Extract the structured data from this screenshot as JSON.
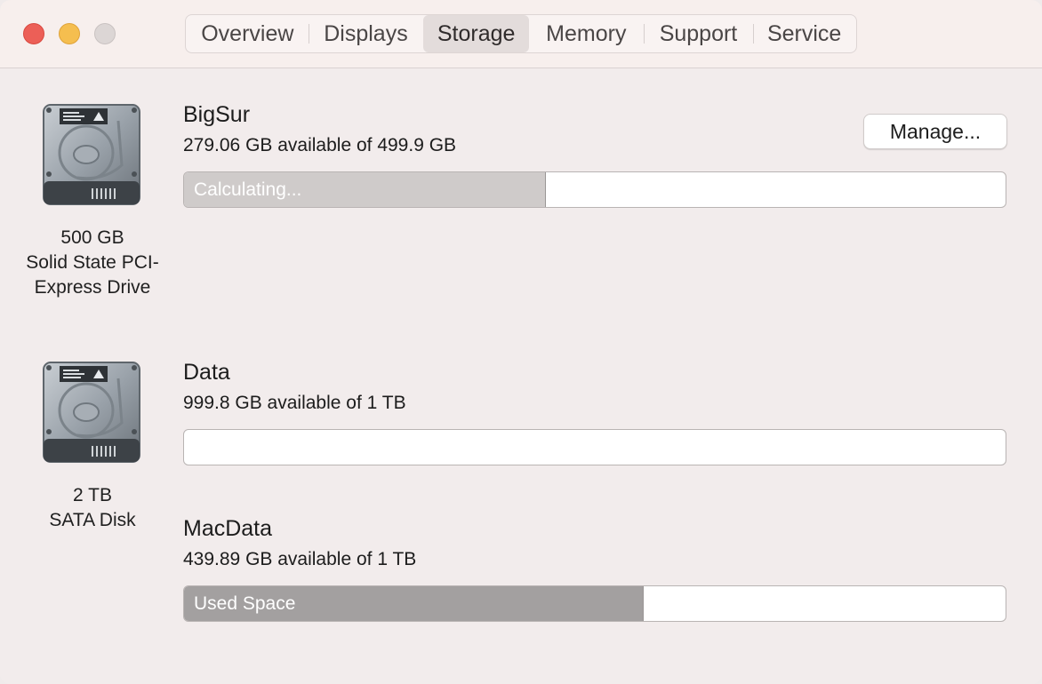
{
  "tabs": [
    {
      "label": "Overview",
      "selected": false
    },
    {
      "label": "Displays",
      "selected": false
    },
    {
      "label": "Storage",
      "selected": true
    },
    {
      "label": "Memory",
      "selected": false
    },
    {
      "label": "Support",
      "selected": false
    },
    {
      "label": "Service",
      "selected": false
    }
  ],
  "drives": [
    {
      "icon": "hard-drive-icon",
      "size": "500 GB",
      "type_line1": "Solid State PCI-",
      "type_line2": "Express Drive",
      "volumes": [
        {
          "name": "BigSur",
          "available": "279.06 GB available of 499.9 GB",
          "bar_label": "Calculating...",
          "bar_fraction": 0.44,
          "manage_label": "Manage..."
        }
      ]
    },
    {
      "icon": "hard-drive-icon",
      "size": "2 TB",
      "type_line1": "SATA Disk",
      "volumes": [
        {
          "name": "Data",
          "available": "999.8 GB available of 1 TB",
          "bar_label": "",
          "bar_fraction": 0.0
        },
        {
          "name": "MacData",
          "available": "439.89 GB available of 1 TB",
          "bar_label": "Used Space",
          "bar_fraction": 0.56
        }
      ]
    }
  ],
  "colors": {
    "close": "#ec5f57",
    "minimize": "#f5be4f",
    "zoom_disabled": "#dcd6d5",
    "calculating_fill": "#cfcbca",
    "used_fill": "#a3a0a0"
  }
}
